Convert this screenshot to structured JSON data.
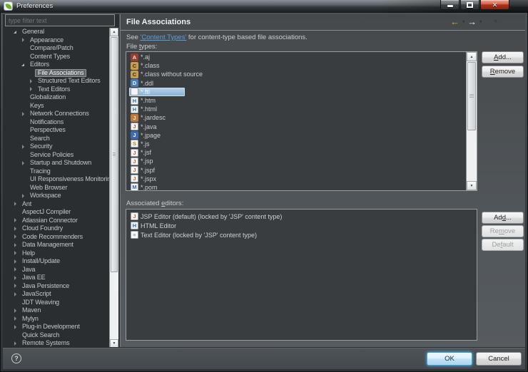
{
  "colors": {
    "selection_blue": "#9dc2e2",
    "tree_selection_gray": "#5d6366",
    "link_blue": "#5d9fd4",
    "back_arrow_gold": "#d9a83c",
    "close_button_red": "#ad3520",
    "panel_dark": "#393d40",
    "frame_gray": "#4c5154"
  },
  "titlebar": {
    "title": "Preferences",
    "app_icon": "spring-leaf-icon",
    "window_controls": [
      "minimize",
      "maximize",
      "close"
    ]
  },
  "sidebar": {
    "filter": {
      "placeholder": "type filter text"
    },
    "tree": [
      {
        "label": "General",
        "level": 1,
        "expander": "expanded"
      },
      {
        "label": "Appearance",
        "level": 2,
        "expander": "collapsed"
      },
      {
        "label": "Compare/Patch",
        "level": 2,
        "expander": "none"
      },
      {
        "label": "Content Types",
        "level": 2,
        "expander": "none"
      },
      {
        "label": "Editors",
        "level": 2,
        "expander": "expanded"
      },
      {
        "label": "File Associations",
        "level": 3,
        "expander": "none",
        "selected": true
      },
      {
        "label": "Structured Text Editors",
        "level": 3,
        "expander": "collapsed"
      },
      {
        "label": "Text Editors",
        "level": 3,
        "expander": "collapsed"
      },
      {
        "label": "Globalization",
        "level": 2,
        "expander": "none"
      },
      {
        "label": "Keys",
        "level": 2,
        "expander": "none"
      },
      {
        "label": "Network Connections",
        "level": 2,
        "expander": "collapsed"
      },
      {
        "label": "Notifications",
        "level": 2,
        "expander": "none"
      },
      {
        "label": "Perspectives",
        "level": 2,
        "expander": "none"
      },
      {
        "label": "Search",
        "level": 2,
        "expander": "none"
      },
      {
        "label": "Security",
        "level": 2,
        "expander": "collapsed"
      },
      {
        "label": "Service Policies",
        "level": 2,
        "expander": "none"
      },
      {
        "label": "Startup and Shutdown",
        "level": 2,
        "expander": "collapsed"
      },
      {
        "label": "Tracing",
        "level": 2,
        "expander": "none"
      },
      {
        "label": "UI Responsiveness Monitoring",
        "level": 2,
        "expander": "none"
      },
      {
        "label": "Web Browser",
        "level": 2,
        "expander": "none"
      },
      {
        "label": "Workspace",
        "level": 2,
        "expander": "collapsed"
      },
      {
        "label": "Ant",
        "level": 1,
        "expander": "collapsed"
      },
      {
        "label": "AspectJ Compiler",
        "level": 1,
        "expander": "none"
      },
      {
        "label": "Atlassian Connector",
        "level": 1,
        "expander": "collapsed"
      },
      {
        "label": "Cloud Foundry",
        "level": 1,
        "expander": "collapsed"
      },
      {
        "label": "Code Recommenders",
        "level": 1,
        "expander": "collapsed"
      },
      {
        "label": "Data Management",
        "level": 1,
        "expander": "collapsed"
      },
      {
        "label": "Help",
        "level": 1,
        "expander": "collapsed"
      },
      {
        "label": "Install/Update",
        "level": 1,
        "expander": "collapsed"
      },
      {
        "label": "Java",
        "level": 1,
        "expander": "collapsed"
      },
      {
        "label": "Java EE",
        "level": 1,
        "expander": "collapsed"
      },
      {
        "label": "Java Persistence",
        "level": 1,
        "expander": "collapsed"
      },
      {
        "label": "JavaScript",
        "level": 1,
        "expander": "collapsed"
      },
      {
        "label": "JDT Weaving",
        "level": 1,
        "expander": "none"
      },
      {
        "label": "Maven",
        "level": 1,
        "expander": "collapsed"
      },
      {
        "label": "Mylyn",
        "level": 1,
        "expander": "collapsed"
      },
      {
        "label": "Plug-in Development",
        "level": 1,
        "expander": "collapsed"
      },
      {
        "label": "Quick Search",
        "level": 1,
        "expander": "none"
      },
      {
        "label": "Remote Systems",
        "level": 1,
        "expander": "collapsed"
      }
    ]
  },
  "main": {
    "title": "File Associations",
    "nav_icons": [
      "back-arrow-icon",
      "back-dropdown-icon",
      "forward-arrow-icon",
      "forward-dropdown-icon",
      "view-menu-icon"
    ],
    "description": {
      "prefix": "See ",
      "link": "'Content Types'",
      "suffix": " for content-type based file associations."
    },
    "file_types": {
      "label": "File types:",
      "mnemonic_index": 5,
      "items": [
        {
          "name": "*.aj",
          "icon": "aj-file-icon"
        },
        {
          "name": "*.class",
          "icon": "class-file-icon"
        },
        {
          "name": "*.class without source",
          "icon": "class-file-icon"
        },
        {
          "name": "*.ddl",
          "icon": "ddl-file-icon"
        },
        {
          "name": "*.ftl",
          "icon": "text-file-icon",
          "selected": true
        },
        {
          "name": "*.htm",
          "icon": "html-file-icon"
        },
        {
          "name": "*.html",
          "icon": "html-file-icon"
        },
        {
          "name": "*.jardesc",
          "icon": "jar-file-icon"
        },
        {
          "name": "*.java",
          "icon": "java-file-icon"
        },
        {
          "name": "*.jpage",
          "icon": "jpage-file-icon"
        },
        {
          "name": "*.js",
          "icon": "js-file-icon"
        },
        {
          "name": "*.jsf",
          "icon": "jsp-file-icon"
        },
        {
          "name": "*.jsp",
          "icon": "jsp-file-icon"
        },
        {
          "name": "*.jspf",
          "icon": "jsp-file-icon"
        },
        {
          "name": "*.jspx",
          "icon": "jsp-file-icon"
        },
        {
          "name": "*.pom",
          "icon": "pom-file-icon"
        }
      ],
      "buttons": [
        {
          "label": "Add...",
          "underline": 0,
          "enabled": true
        },
        {
          "label": "Remove",
          "underline": 0,
          "enabled": true
        }
      ]
    },
    "associated_editors": {
      "label": "Associated editors:",
      "mnemonic_index": 11,
      "items": [
        {
          "name": "JSP Editor (default) (locked by 'JSP' content type)",
          "icon": "jsp-editor-icon"
        },
        {
          "name": "HTML Editor",
          "icon": "html-editor-icon"
        },
        {
          "name": "Text Editor (locked by 'JSP' content type)",
          "icon": "text-editor-icon"
        }
      ],
      "buttons": [
        {
          "label": "Add...",
          "underline": 2,
          "enabled": true
        },
        {
          "label": "Remove",
          "underline": 2,
          "enabled": false
        },
        {
          "label": "Default",
          "underline": 2,
          "enabled": false
        }
      ]
    }
  },
  "footer": {
    "help": "?",
    "ok": "OK",
    "cancel": "Cancel"
  },
  "icon_glyphs": {
    "aj-file-icon": {
      "glyph": "A",
      "bg": "#94402f",
      "fg": "#f2e0d5"
    },
    "class-file-icon": {
      "glyph": "C",
      "bg": "#c79d52",
      "fg": "#3d2f12"
    },
    "ddl-file-icon": {
      "glyph": "D",
      "bg": "#4a7fb5",
      "fg": "#eaf2fa"
    },
    "text-file-icon": {
      "glyph": "",
      "bg": "#f2f4f5",
      "fg": "#888e92",
      "border": "#9aa0a4"
    },
    "html-file-icon": {
      "glyph": "H",
      "bg": "#eef3f6",
      "fg": "#2e6fb0",
      "border": "#9aa0a4"
    },
    "jar-file-icon": {
      "glyph": "J",
      "bg": "#c07a3e",
      "fg": "#fff3e4"
    },
    "java-file-icon": {
      "glyph": "J",
      "bg": "#f2f4f5",
      "fg": "#c2512f",
      "border": "#9aa0a4"
    },
    "jpage-file-icon": {
      "glyph": "J",
      "bg": "#3f6db5",
      "fg": "#ffffff"
    },
    "js-file-icon": {
      "glyph": "S",
      "bg": "#f2f4f5",
      "fg": "#b58a2a",
      "border": "#9aa0a4"
    },
    "jsp-file-icon": {
      "glyph": "J",
      "bg": "#f2f4f5",
      "fg": "#d2622a",
      "border": "#9aa0a4"
    },
    "pom-file-icon": {
      "glyph": "M",
      "bg": "#f2f4f5",
      "fg": "#3a62a8",
      "border": "#9aa0a4"
    },
    "jsp-editor-icon": {
      "glyph": "J",
      "bg": "#f2f4f5",
      "fg": "#d2622a",
      "border": "#9aa0a4"
    },
    "html-editor-icon": {
      "glyph": "H",
      "bg": "#eef3f6",
      "fg": "#2e6fb0",
      "border": "#9aa0a4"
    },
    "text-editor-icon": {
      "glyph": "≡",
      "bg": "#f6f8f9",
      "fg": "#8b9196",
      "border": "#9aa0a4"
    }
  }
}
